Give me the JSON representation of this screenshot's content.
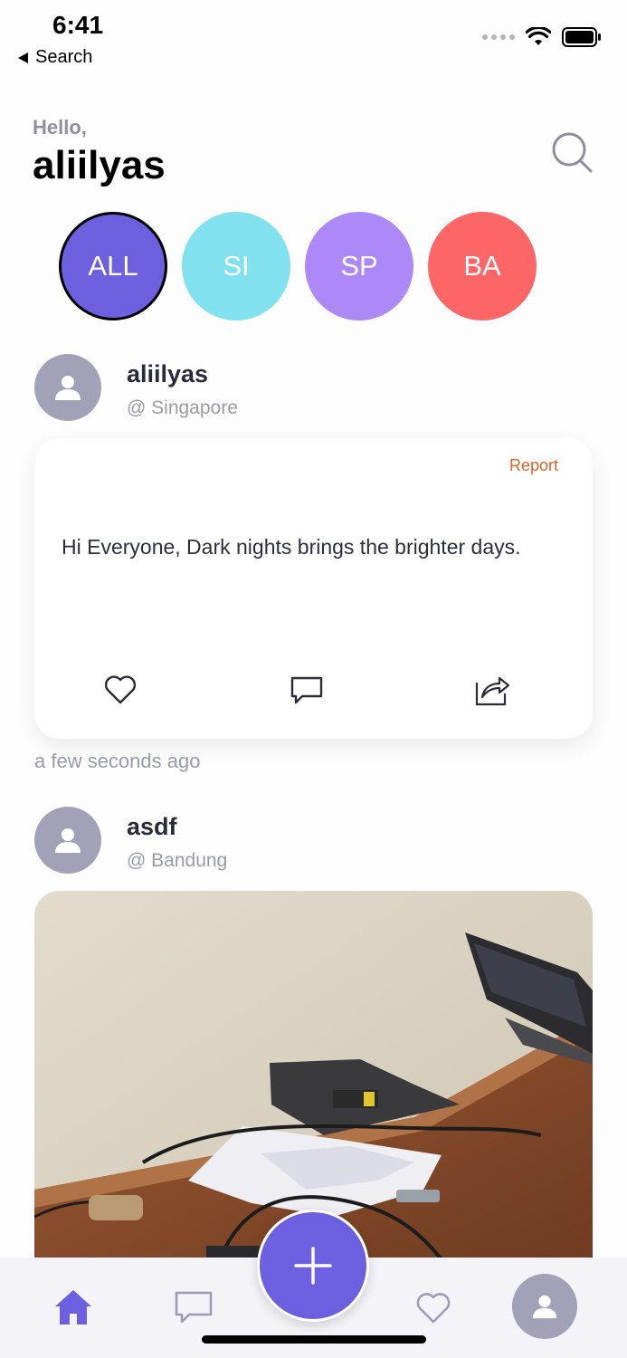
{
  "status_bar": {
    "time": "6:41",
    "back_label": "Search"
  },
  "header": {
    "greeting": "Hello,",
    "username": "aliilyas"
  },
  "categories": [
    {
      "label": "ALL",
      "color": "#6d5fde",
      "active": true
    },
    {
      "label": "SI",
      "color": "#82e1ee",
      "active": false
    },
    {
      "label": "SP",
      "color": "#ad89f7",
      "active": false
    },
    {
      "label": "BA",
      "color": "#fc6666",
      "active": false
    }
  ],
  "posts": [
    {
      "author": "aliilyas",
      "location": "@ Singapore",
      "report_label": "Report",
      "text": "Hi Everyone, Dark nights brings the brighter days.",
      "time": "a few seconds ago"
    },
    {
      "author": "asdf",
      "location": "@ Bandung"
    }
  ],
  "tab_bar": {
    "icons": [
      "home-icon",
      "chat-icon",
      "add-icon",
      "heart-icon",
      "profile-icon"
    ],
    "active": "home-icon"
  },
  "colors": {
    "accent": "#6c5fe0",
    "report": "#e0622a",
    "muted": "#9a9aa9"
  }
}
